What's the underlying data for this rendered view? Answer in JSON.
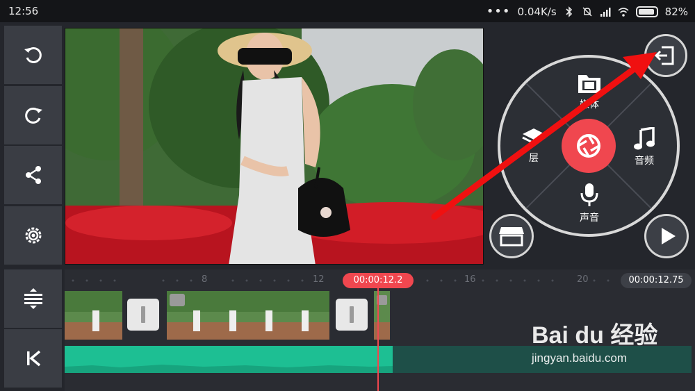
{
  "status_bar": {
    "time": "12:56",
    "net_speed": "0.04K/s",
    "battery": "82%"
  },
  "left_toolbar": {
    "items": [
      {
        "name": "undo",
        "icon": "undo-icon"
      },
      {
        "name": "redo",
        "icon": "redo-icon"
      },
      {
        "name": "share",
        "icon": "share-icon"
      },
      {
        "name": "settings",
        "icon": "gear-icon"
      },
      {
        "name": "timeline-expand",
        "icon": "expand-vertical-icon"
      },
      {
        "name": "jump-to-start",
        "icon": "skip-start-icon"
      }
    ]
  },
  "menu": {
    "media": "媒体",
    "layer": "层",
    "audio": "音频",
    "voice": "声音"
  },
  "timeline": {
    "ruler": [
      "8",
      "12",
      "16",
      "20"
    ],
    "playhead_time": "00:00:12.2",
    "total_time": "00:00:12.75"
  },
  "watermark": {
    "brand": "Bai du 经验",
    "url": "jingyan.baidu.com"
  },
  "colors": {
    "accent": "#f0474f",
    "audio": "#1dbf93",
    "panel": "#3a3d44"
  }
}
